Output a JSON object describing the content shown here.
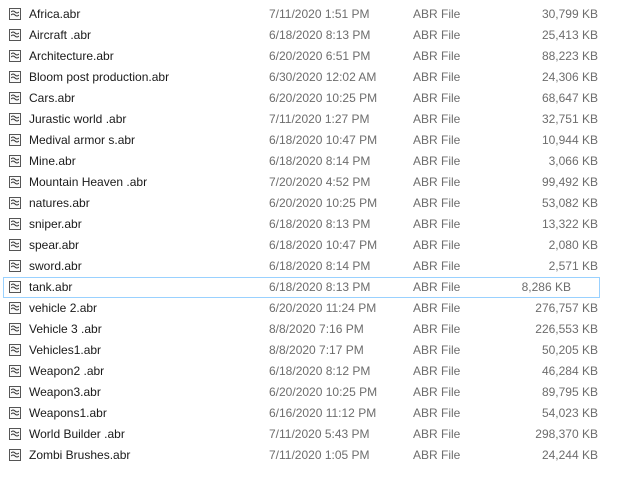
{
  "files": [
    {
      "name": "Africa.abr",
      "date": "7/11/2020 1:51 PM",
      "type": "ABR File",
      "size": "30,799 KB",
      "icon": "brush-file-icon"
    },
    {
      "name": "Aircraft .abr",
      "date": "6/18/2020 8:13 PM",
      "type": "ABR File",
      "size": "25,413 KB",
      "icon": "brush-file-icon"
    },
    {
      "name": "Architecture.abr",
      "date": "6/20/2020 6:51 PM",
      "type": "ABR File",
      "size": "88,223 KB",
      "icon": "brush-file-icon"
    },
    {
      "name": "Bloom post production.abr",
      "date": "6/30/2020 12:02 AM",
      "type": "ABR File",
      "size": "24,306 KB",
      "icon": "brush-file-icon"
    },
    {
      "name": "Cars.abr",
      "date": "6/20/2020 10:25 PM",
      "type": "ABR File",
      "size": "68,647 KB",
      "icon": "brush-file-icon"
    },
    {
      "name": "Jurastic world .abr",
      "date": "7/11/2020 1:27 PM",
      "type": "ABR File",
      "size": "32,751 KB",
      "icon": "brush-file-icon"
    },
    {
      "name": "Medival armor s.abr",
      "date": "6/18/2020 10:47 PM",
      "type": "ABR File",
      "size": "10,944 KB",
      "icon": "brush-file-icon"
    },
    {
      "name": "Mine.abr",
      "date": "6/18/2020 8:14 PM",
      "type": "ABR File",
      "size": "3,066 KB",
      "icon": "brush-file-icon"
    },
    {
      "name": "Mountain Heaven .abr",
      "date": "7/20/2020 4:52 PM",
      "type": "ABR File",
      "size": "99,492 KB",
      "icon": "brush-file-icon"
    },
    {
      "name": "natures.abr",
      "date": "6/20/2020 10:25 PM",
      "type": "ABR File",
      "size": "53,082 KB",
      "icon": "brush-file-icon"
    },
    {
      "name": "sniper.abr",
      "date": "6/18/2020 8:13 PM",
      "type": "ABR File",
      "size": "13,322 KB",
      "icon": "brush-file-icon"
    },
    {
      "name": "spear.abr",
      "date": "6/18/2020 10:47 PM",
      "type": "ABR File",
      "size": "2,080 KB",
      "icon": "brush-file-icon"
    },
    {
      "name": "sword.abr",
      "date": "6/18/2020 8:14 PM",
      "type": "ABR File",
      "size": "2,571 KB",
      "icon": "brush-file-icon"
    },
    {
      "name": "tank.abr",
      "date": "6/18/2020 8:13 PM",
      "type": "ABR File",
      "size": "8,286 KB",
      "icon": "brush-file-icon",
      "selected": true
    },
    {
      "name": "vehicle 2.abr",
      "date": "6/20/2020 11:24 PM",
      "type": "ABR File",
      "size": "276,757 KB",
      "icon": "brush-file-icon"
    },
    {
      "name": "Vehicle 3 .abr",
      "date": "8/8/2020 7:16 PM",
      "type": "ABR File",
      "size": "226,553 KB",
      "icon": "brush-file-icon"
    },
    {
      "name": "Vehicles1.abr",
      "date": "8/8/2020 7:17 PM",
      "type": "ABR File",
      "size": "50,205 KB",
      "icon": "brush-file-icon"
    },
    {
      "name": "Weapon2 .abr",
      "date": "6/18/2020 8:12 PM",
      "type": "ABR File",
      "size": "46,284 KB",
      "icon": "brush-file-icon"
    },
    {
      "name": "Weapon3.abr",
      "date": "6/20/2020 10:25 PM",
      "type": "ABR File",
      "size": "89,795 KB",
      "icon": "brush-file-icon"
    },
    {
      "name": "Weapons1.abr",
      "date": "6/16/2020 11:12 PM",
      "type": "ABR File",
      "size": "54,023 KB",
      "icon": "brush-file-icon"
    },
    {
      "name": "World Builder .abr",
      "date": "7/11/2020 5:43 PM",
      "type": "ABR File",
      "size": "298,370 KB",
      "icon": "brush-file-icon"
    },
    {
      "name": "Zombi Brushes.abr",
      "date": "7/11/2020 1:05 PM",
      "type": "ABR File",
      "size": "24,244 KB",
      "icon": "brush-file-icon"
    }
  ],
  "colors": {
    "selection_border": "#99d1ff",
    "secondary_text": "#6d6d6d",
    "primary_text": "#1a1a1a"
  }
}
